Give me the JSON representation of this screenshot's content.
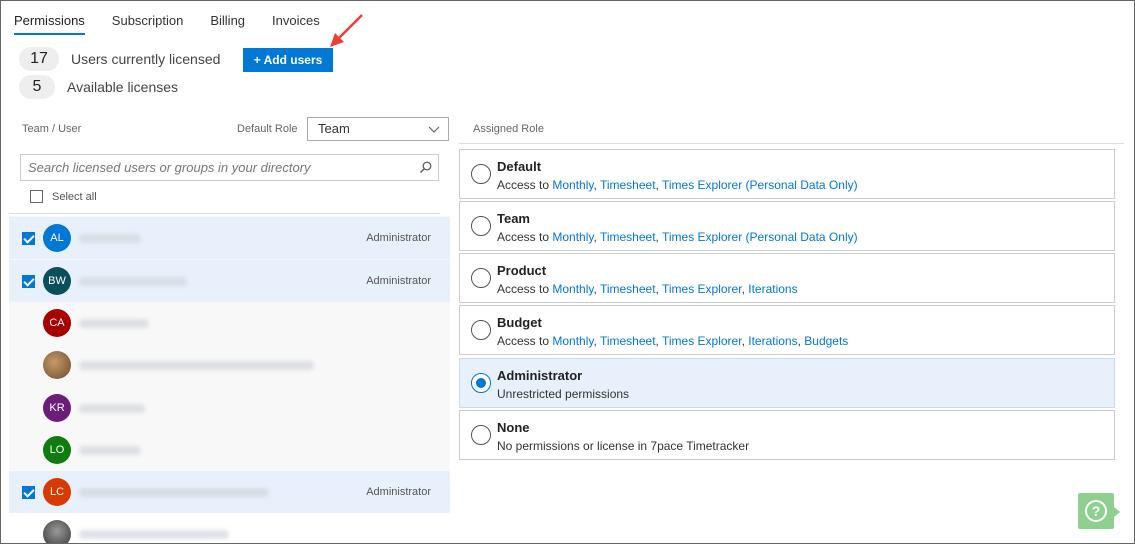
{
  "tabs": [
    {
      "label": "Permissions",
      "active": true
    },
    {
      "label": "Subscription",
      "active": false
    },
    {
      "label": "Billing",
      "active": false
    },
    {
      "label": "Invoices",
      "active": false
    }
  ],
  "licenses": {
    "used_count": "17",
    "used_label": "Users currently licensed",
    "available_count": "5",
    "available_label": "Available licenses",
    "add_button_label": "+ Add users"
  },
  "left_panel": {
    "team_user_header": "Team / User",
    "default_role_label": "Default Role",
    "default_role_value": "Team",
    "search_placeholder": "Search licensed users or groups in your directory",
    "select_all_label": "Select all",
    "users": [
      {
        "initials": "AL",
        "color": "#0078d4",
        "checked": true,
        "role": "Administrator"
      },
      {
        "initials": "BW",
        "color": "#0b4f5c",
        "checked": true,
        "role": "Administrator"
      },
      {
        "initials": "CA",
        "color": "#a80000",
        "checked": false,
        "role": ""
      },
      {
        "initials": "",
        "color": "#8a6a4a",
        "checked": false,
        "role": ""
      },
      {
        "initials": "KR",
        "color": "#6b1d7a",
        "checked": false,
        "role": ""
      },
      {
        "initials": "LO",
        "color": "#107c10",
        "checked": false,
        "role": ""
      },
      {
        "initials": "LC",
        "color": "#d83b01",
        "checked": true,
        "role": "Administrator"
      },
      {
        "initials": "",
        "color": "#555555",
        "checked": false,
        "role": ""
      }
    ]
  },
  "right_panel": {
    "assigned_role_header": "Assigned Role",
    "roles": [
      {
        "title": "Default",
        "prefix": "Access to ",
        "links": [
          "Monthly",
          "Timesheet",
          "Times Explorer (Personal Data Only)"
        ],
        "desc": "",
        "selected": false
      },
      {
        "title": "Team",
        "prefix": "Access to ",
        "links": [
          "Monthly",
          "Timesheet",
          "Times Explorer (Personal Data Only)"
        ],
        "desc": "",
        "selected": false
      },
      {
        "title": "Product",
        "prefix": "Access to ",
        "links": [
          "Monthly",
          "Timesheet",
          "Times Explorer",
          "Iterations"
        ],
        "desc": "",
        "selected": false
      },
      {
        "title": "Budget",
        "prefix": "Access to ",
        "links": [
          "Monthly",
          "Timesheet",
          "Times Explorer",
          "Iterations",
          "Budgets"
        ],
        "desc": "",
        "selected": false
      },
      {
        "title": "Administrator",
        "prefix": "",
        "links": [],
        "desc": "Unrestricted permissions",
        "selected": true
      },
      {
        "title": "None",
        "prefix": "",
        "links": [],
        "desc": "No permissions or license in 7pace Timetracker",
        "selected": false
      }
    ]
  },
  "help": {
    "glyph": "?"
  },
  "colors": {
    "accent": "#0078d4",
    "selected_bg": "#e8f1fb",
    "help_green": "#8fcf8f",
    "annotation_red": "#e8403a"
  }
}
